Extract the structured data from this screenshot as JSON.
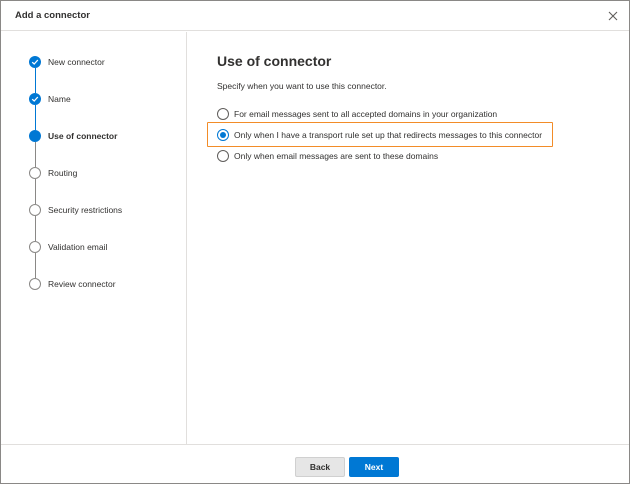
{
  "header": {
    "title": "Add a connector",
    "close_icon": "close-icon"
  },
  "steps": [
    {
      "label": "New connector",
      "state": "done"
    },
    {
      "label": "Name",
      "state": "done"
    },
    {
      "label": "Use of connector",
      "state": "current"
    },
    {
      "label": "Routing",
      "state": "todo"
    },
    {
      "label": "Security restrictions",
      "state": "todo"
    },
    {
      "label": "Validation email",
      "state": "todo"
    },
    {
      "label": "Review connector",
      "state": "todo"
    }
  ],
  "main": {
    "title": "Use of connector",
    "description": "Specify when you want to use this connector.",
    "options": [
      {
        "label": "For email messages sent to all accepted domains in your organization",
        "checked": false
      },
      {
        "label": "Only when I have a transport rule set up that redirects messages to this connector",
        "checked": true
      },
      {
        "label": "Only when email messages are sent to these domains",
        "checked": false
      }
    ]
  },
  "footer": {
    "back_label": "Back",
    "next_label": "Next"
  },
  "colors": {
    "accent": "#0078d4",
    "highlight": "#f28c28",
    "border": "#e1dfdd"
  }
}
